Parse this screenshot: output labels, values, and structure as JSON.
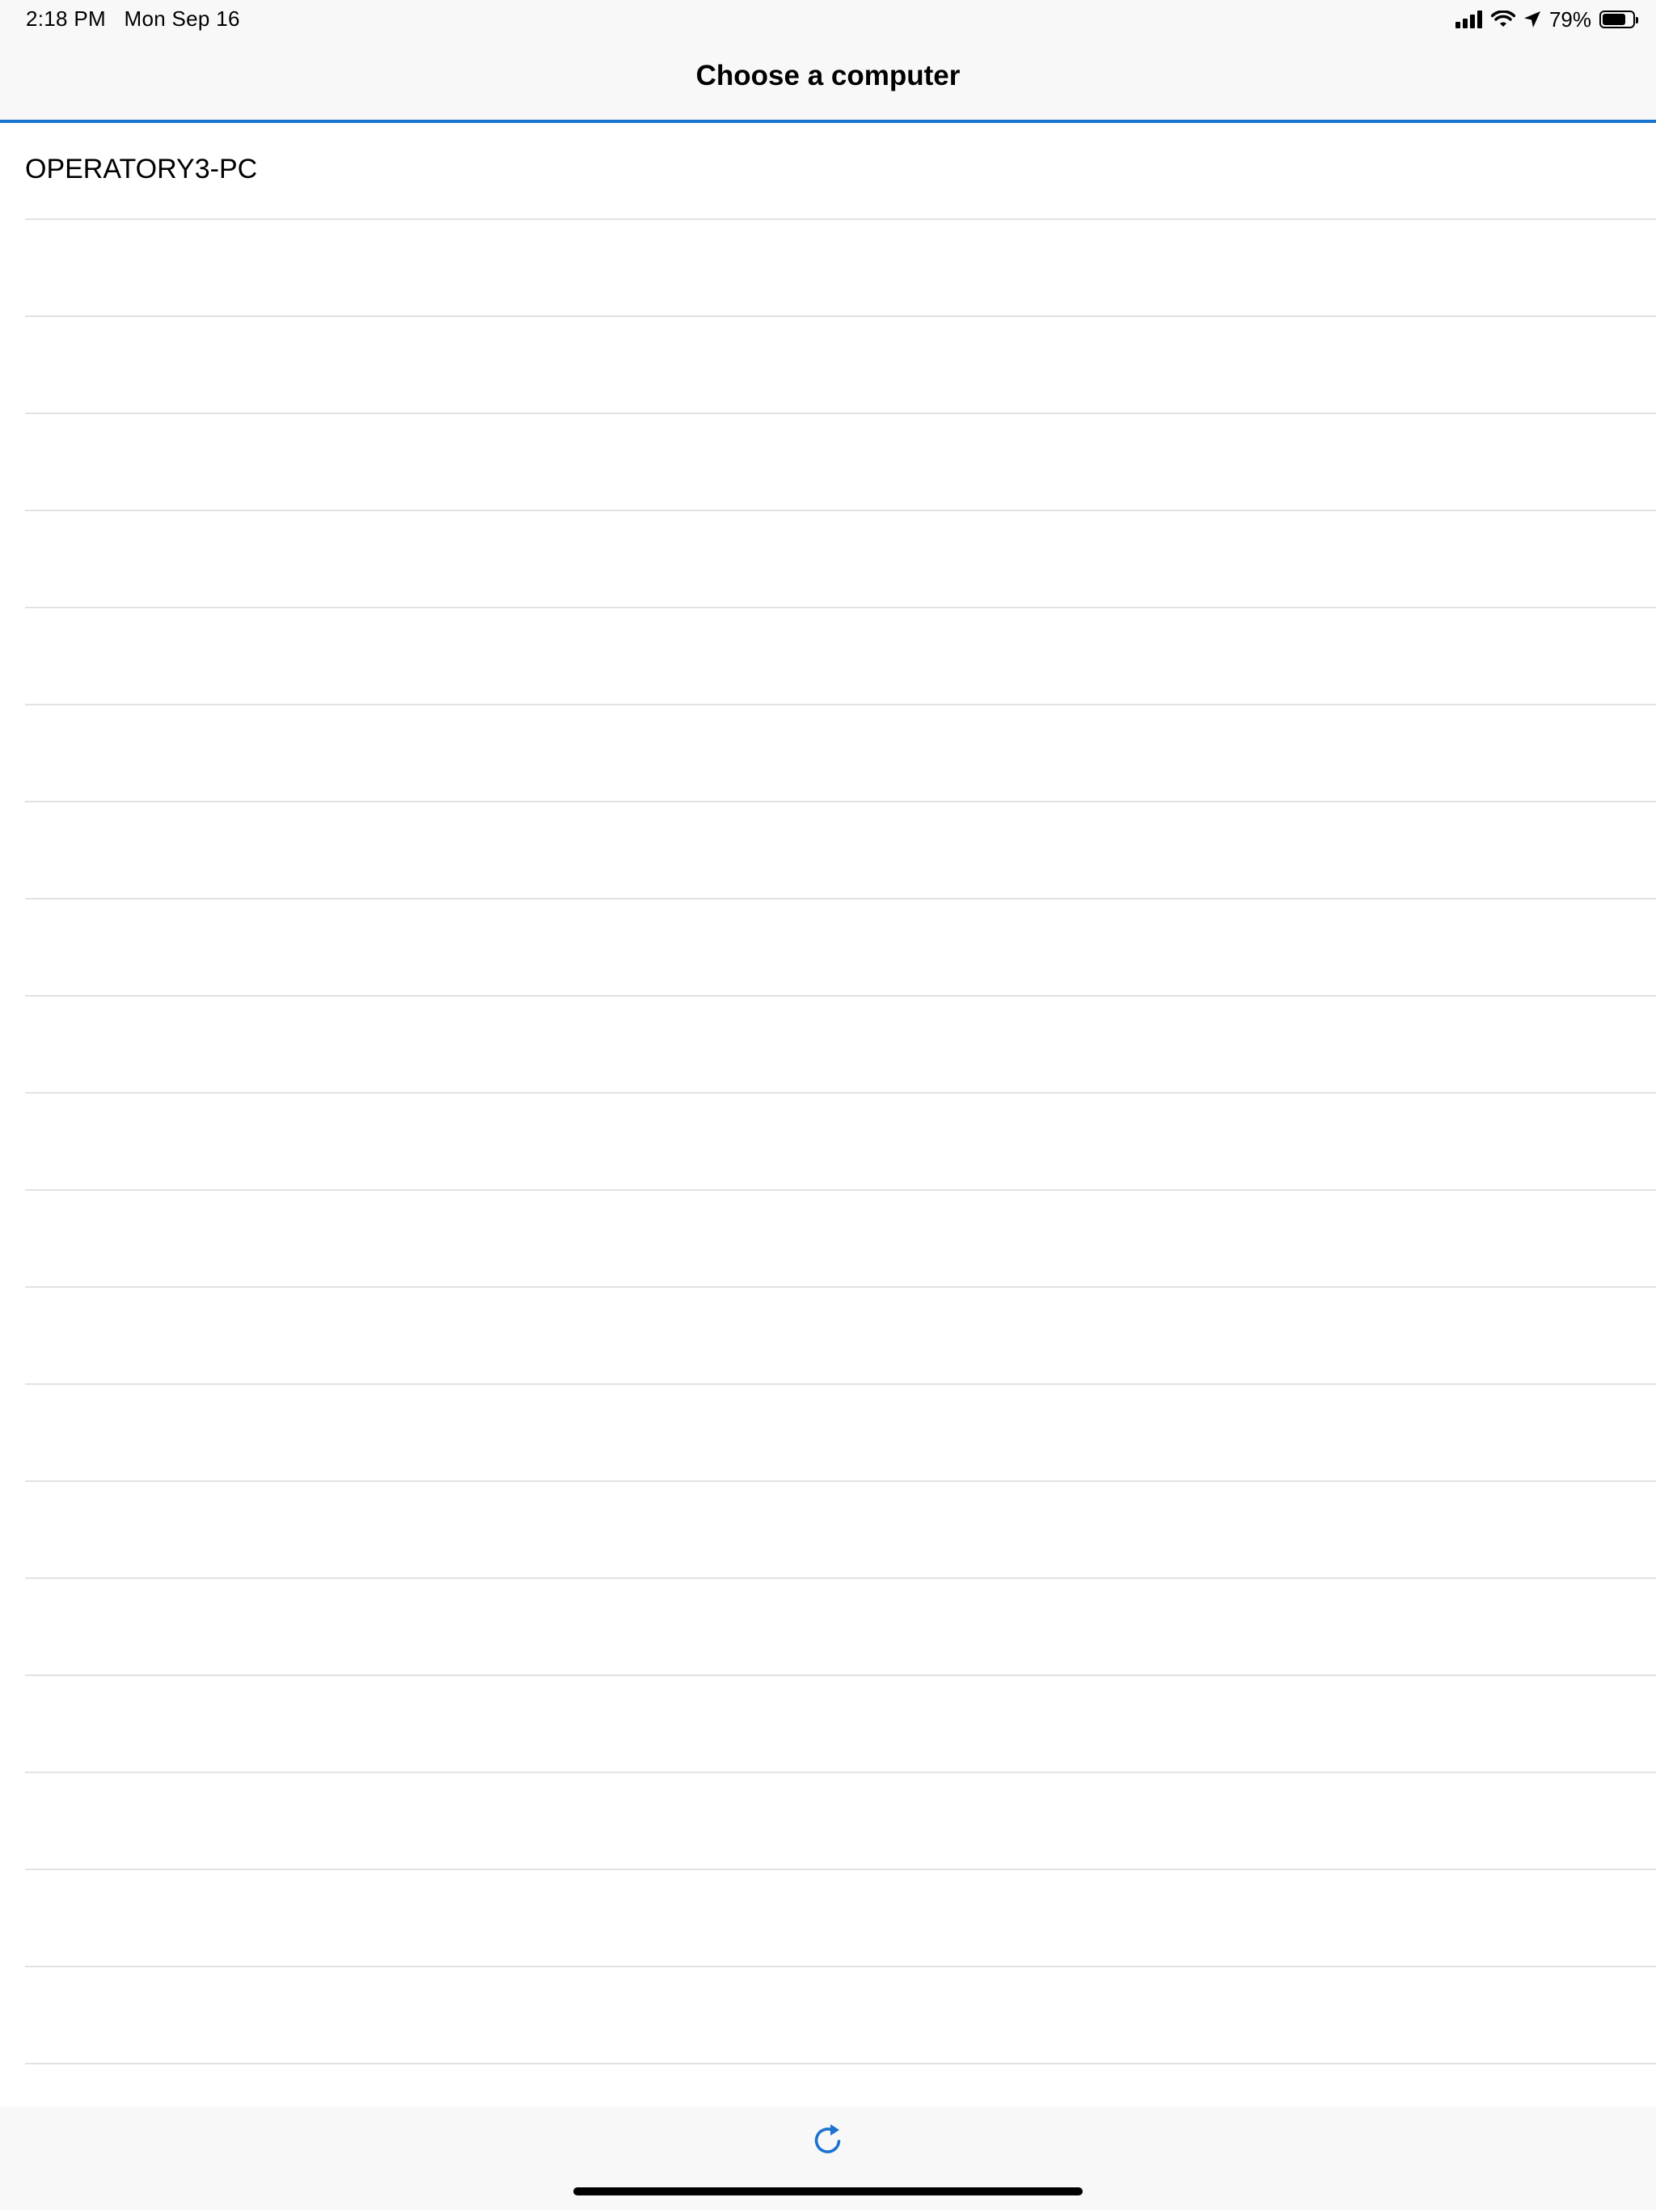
{
  "status_bar": {
    "time": "2:18 PM",
    "date": "Mon Sep 16",
    "battery_percent": "79%",
    "battery_level": 0.79,
    "icons": [
      "cellular-signal-icon",
      "wifi-icon",
      "location-arrow-icon",
      "battery-icon"
    ]
  },
  "nav": {
    "title": "Choose a computer"
  },
  "computers": [
    {
      "label": "OPERATORY3-PC"
    },
    {
      "label": ""
    },
    {
      "label": ""
    },
    {
      "label": ""
    },
    {
      "label": ""
    },
    {
      "label": ""
    },
    {
      "label": ""
    },
    {
      "label": ""
    },
    {
      "label": ""
    },
    {
      "label": ""
    },
    {
      "label": ""
    },
    {
      "label": ""
    },
    {
      "label": ""
    },
    {
      "label": ""
    },
    {
      "label": ""
    },
    {
      "label": ""
    },
    {
      "label": ""
    },
    {
      "label": ""
    },
    {
      "label": ""
    },
    {
      "label": ""
    },
    {
      "label": ""
    }
  ],
  "toolbar": {
    "refresh_icon": "refresh-icon"
  },
  "colors": {
    "accent": "#1a73d1",
    "bar_background": "#f8f8f8",
    "separator": "#e2e2e4"
  }
}
